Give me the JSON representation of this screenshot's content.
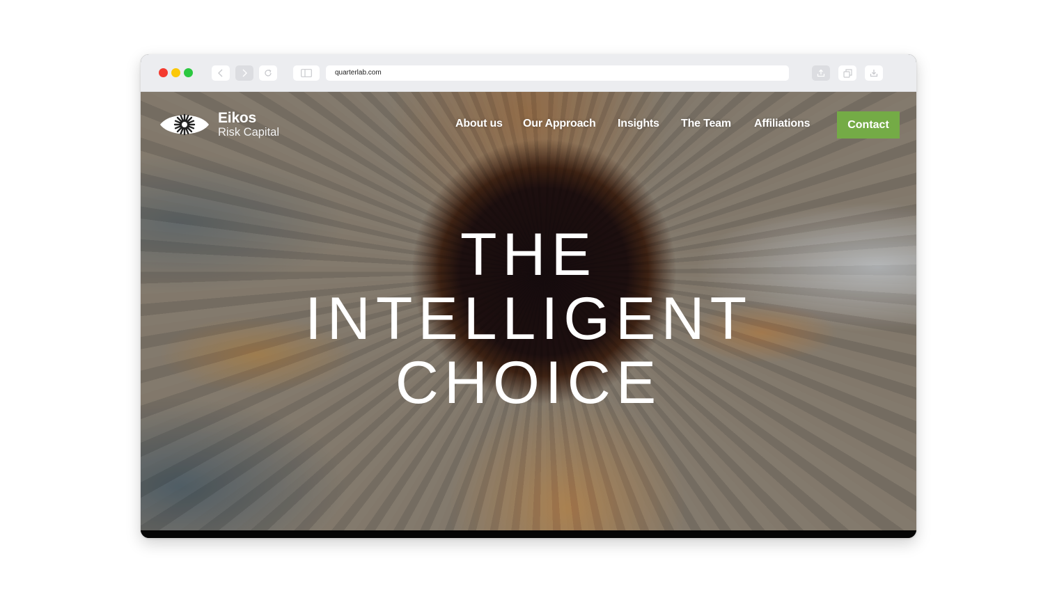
{
  "browser": {
    "address": "quarterlab.com",
    "icons": {
      "back": "chevron-left-icon",
      "forward": "chevron-right-icon",
      "reload": "reload-icon",
      "sidebar": "sidebar-icon",
      "share": "share-icon",
      "tabs": "tabs-overview-icon",
      "download": "download-icon"
    },
    "traffic_colors": {
      "close": "#f43a2f",
      "minimize": "#fbc808",
      "zoom": "#2bc840"
    }
  },
  "site": {
    "logo": {
      "icon": "eye-icon",
      "name": "Eikos",
      "subtitle": "Risk Capital"
    },
    "nav": [
      {
        "label": "About us"
      },
      {
        "label": "Our Approach"
      },
      {
        "label": "Insights"
      },
      {
        "label": "The Team"
      },
      {
        "label": "Affiliations"
      }
    ],
    "cta": {
      "label": "Contact",
      "color": "#74ab46"
    },
    "hero": {
      "lines": [
        "THE",
        "INTELLIGENT",
        "CHOICE"
      ]
    }
  }
}
